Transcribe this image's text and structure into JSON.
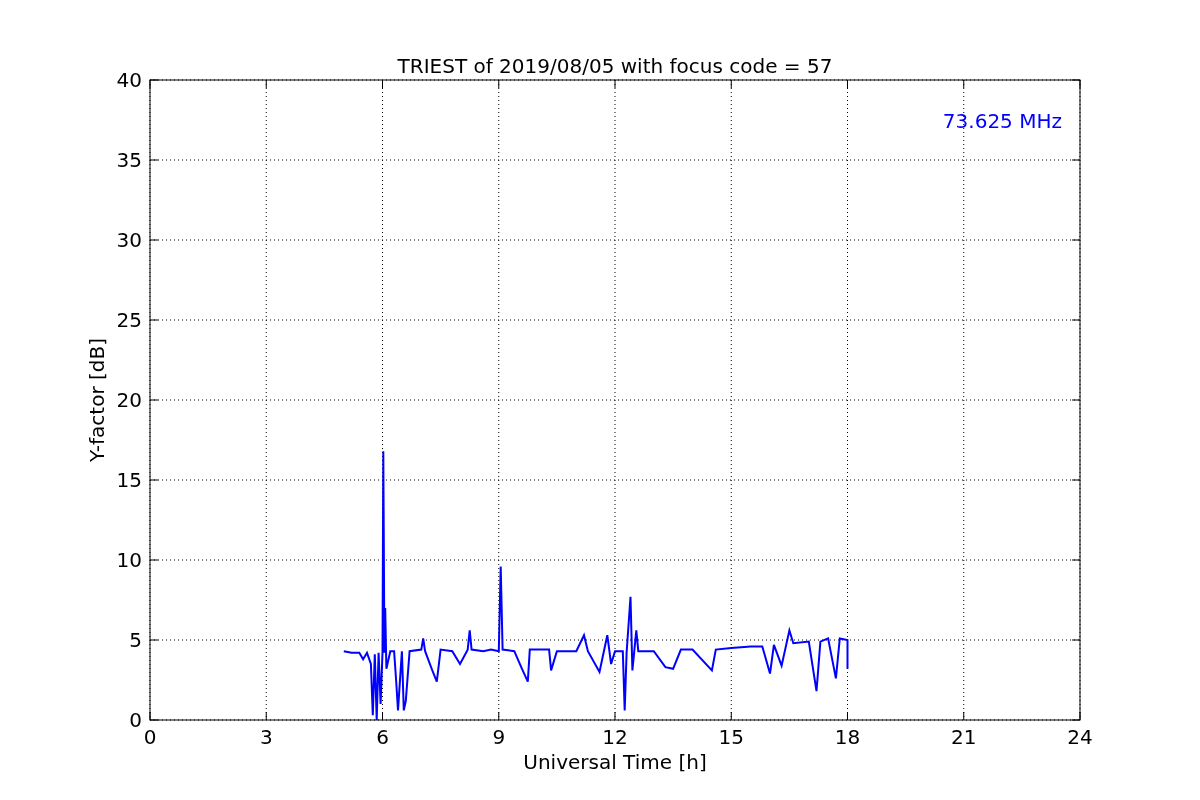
{
  "chart_data": {
    "type": "line",
    "title": "TRIEST of 2019/08/05 with focus code = 57",
    "xlabel": "Universal Time [h]",
    "ylabel": "Y-factor [dB]",
    "xlim": [
      0,
      24
    ],
    "ylim": [
      0,
      40
    ],
    "grid": true,
    "xticks": [
      0,
      3,
      6,
      9,
      12,
      15,
      18,
      21,
      24
    ],
    "yticks": [
      0,
      5,
      10,
      15,
      20,
      25,
      30,
      35,
      40
    ],
    "series": [
      {
        "name": "73.625 MHz",
        "color": "#0000ff",
        "x": [
          5.0,
          5.2,
          5.4,
          5.5,
          5.6,
          5.7,
          5.75,
          5.8,
          5.85,
          5.9,
          5.95,
          6.0,
          6.02,
          6.05,
          6.07,
          6.1,
          6.2,
          6.3,
          6.35,
          6.4,
          6.5,
          6.55,
          6.6,
          6.7,
          7.0,
          7.05,
          7.1,
          7.3,
          7.4,
          7.5,
          7.8,
          8.0,
          8.2,
          8.25,
          8.3,
          8.6,
          8.8,
          9.0,
          9.05,
          9.1,
          9.4,
          9.6,
          9.75,
          9.8,
          10.0,
          10.3,
          10.35,
          10.5,
          11.0,
          11.2,
          11.3,
          11.6,
          11.8,
          11.9,
          12.0,
          12.2,
          12.25,
          12.3,
          12.4,
          12.45,
          12.55,
          12.6,
          13.0,
          13.3,
          13.5,
          13.7,
          14.0,
          14.5,
          14.6,
          15.0,
          15.5,
          15.8,
          16.0,
          16.1,
          16.3,
          16.5,
          16.6,
          17.0,
          17.2,
          17.3,
          17.5,
          17.7,
          17.8,
          18.0,
          18.0
        ],
        "values": [
          4.3,
          4.2,
          4.2,
          3.8,
          4.2,
          3.5,
          0.3,
          4.1,
          0.0,
          4.2,
          1.0,
          4.2,
          16.8,
          4.2,
          7.0,
          3.2,
          4.3,
          4.3,
          2.5,
          0.6,
          4.3,
          0.6,
          1.2,
          4.3,
          4.4,
          5.1,
          4.3,
          3.0,
          2.4,
          4.4,
          4.3,
          3.5,
          4.4,
          5.6,
          4.4,
          4.3,
          4.4,
          4.3,
          9.6,
          4.4,
          4.3,
          3.2,
          2.4,
          4.4,
          4.4,
          4.4,
          3.1,
          4.3,
          4.3,
          5.3,
          4.3,
          3.0,
          5.3,
          3.5,
          4.3,
          4.3,
          0.6,
          4.2,
          7.7,
          3.1,
          5.6,
          4.3,
          4.3,
          3.3,
          3.2,
          4.4,
          4.4,
          3.1,
          4.4,
          4.5,
          4.6,
          4.6,
          2.9,
          4.7,
          3.4,
          5.6,
          4.8,
          4.9,
          1.8,
          4.9,
          5.1,
          2.6,
          5.1,
          5.0,
          3.2
        ]
      }
    ]
  }
}
